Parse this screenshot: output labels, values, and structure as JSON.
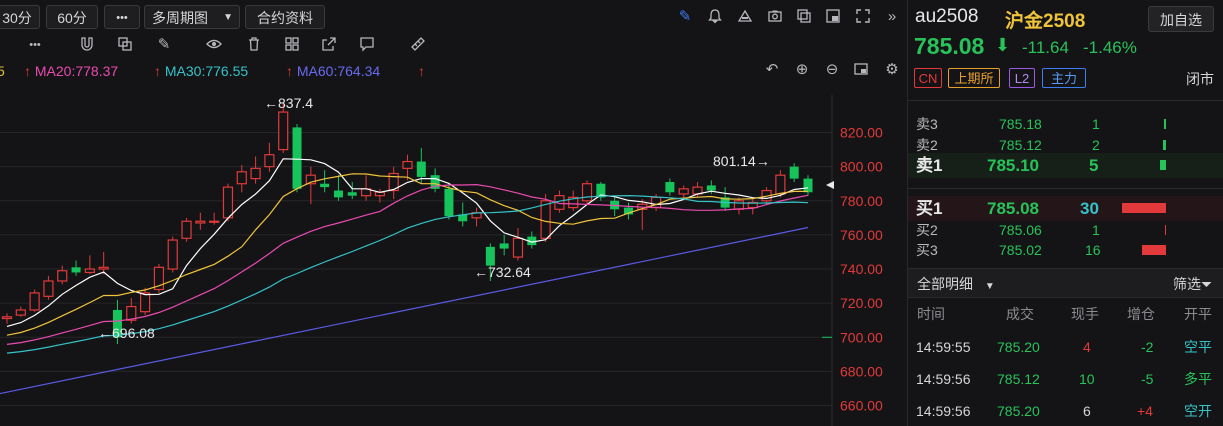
{
  "toolbar": {
    "btn_30": "30分",
    "btn_60": "60分",
    "btn_more": "•••",
    "btn_multi": "多周期图",
    "btn_contract": "合约资料",
    "icons": [
      "pen-icon",
      "bell-icon",
      "alert-icon",
      "camera-icon",
      "window-icon",
      "layout-icon",
      "fullscreen-icon",
      "collapse-icon"
    ]
  },
  "indicators": {
    "ma20": "MA20:778.37",
    "ma30": "MA30:776.55",
    "ma60": "MA60:764.34",
    "colors": {
      "ma5": "#ffffff",
      "ma10": "#f0c43a",
      "ma20": "#e94bb0",
      "ma30": "#35c3c8",
      "ma60": "#5a5ae6"
    }
  },
  "chart_data": {
    "type": "candlestick",
    "y_ticks": [
      "820.00",
      "800.00",
      "780.00",
      "760.00",
      "740.00",
      "720.00",
      "700.00",
      "680.00",
      "660.00"
    ],
    "ylim": [
      648,
      842
    ],
    "annotations": {
      "high": "←837.4",
      "low1": "←696.08",
      "low2": "←732.64",
      "recent": "801.14→"
    },
    "candles": [
      {
        "o": 711,
        "h": 714,
        "l": 708,
        "c": 712
      },
      {
        "o": 713,
        "h": 718,
        "l": 712,
        "c": 716
      },
      {
        "o": 716,
        "h": 728,
        "l": 715,
        "c": 726
      },
      {
        "o": 724,
        "h": 736,
        "l": 722,
        "c": 733
      },
      {
        "o": 733,
        "h": 742,
        "l": 731,
        "c": 739
      },
      {
        "o": 741,
        "h": 745,
        "l": 736,
        "c": 738
      },
      {
        "o": 738,
        "h": 748,
        "l": 737,
        "c": 740
      },
      {
        "o": 740,
        "h": 750,
        "l": 737,
        "c": 741
      },
      {
        "o": 716,
        "h": 722,
        "l": 696,
        "c": 700
      },
      {
        "o": 710,
        "h": 723,
        "l": 708,
        "c": 718
      },
      {
        "o": 715,
        "h": 729,
        "l": 713,
        "c": 726
      },
      {
        "o": 728,
        "h": 743,
        "l": 726,
        "c": 741
      },
      {
        "o": 740,
        "h": 759,
        "l": 738,
        "c": 757
      },
      {
        "o": 758,
        "h": 770,
        "l": 756,
        "c": 768
      },
      {
        "o": 767,
        "h": 773,
        "l": 763,
        "c": 768
      },
      {
        "o": 768,
        "h": 773,
        "l": 766,
        "c": 768
      },
      {
        "o": 770,
        "h": 790,
        "l": 768,
        "c": 788
      },
      {
        "o": 790,
        "h": 801,
        "l": 785,
        "c": 797
      },
      {
        "o": 793,
        "h": 806,
        "l": 790,
        "c": 799
      },
      {
        "o": 800,
        "h": 814,
        "l": 797,
        "c": 807
      },
      {
        "o": 810,
        "h": 837,
        "l": 808,
        "c": 832
      },
      {
        "o": 823,
        "h": 825,
        "l": 785,
        "c": 787
      },
      {
        "o": 790,
        "h": 800,
        "l": 778,
        "c": 795
      },
      {
        "o": 790,
        "h": 798,
        "l": 785,
        "c": 788
      },
      {
        "o": 786,
        "h": 795,
        "l": 780,
        "c": 782
      },
      {
        "o": 785,
        "h": 791,
        "l": 781,
        "c": 783
      },
      {
        "o": 783,
        "h": 795,
        "l": 780,
        "c": 787
      },
      {
        "o": 783,
        "h": 787,
        "l": 779,
        "c": 785
      },
      {
        "o": 786,
        "h": 800,
        "l": 781,
        "c": 796
      },
      {
        "o": 799,
        "h": 807,
        "l": 792,
        "c": 803
      },
      {
        "o": 803,
        "h": 811,
        "l": 790,
        "c": 794
      },
      {
        "o": 795,
        "h": 799,
        "l": 785,
        "c": 787
      },
      {
        "o": 787,
        "h": 790,
        "l": 769,
        "c": 771
      },
      {
        "o": 772,
        "h": 779,
        "l": 765,
        "c": 768
      },
      {
        "o": 770,
        "h": 776,
        "l": 765,
        "c": 773
      },
      {
        "o": 753,
        "h": 755,
        "l": 733,
        "c": 742
      },
      {
        "o": 755,
        "h": 760,
        "l": 748,
        "c": 752
      },
      {
        "o": 747,
        "h": 764,
        "l": 745,
        "c": 758
      },
      {
        "o": 759,
        "h": 762,
        "l": 752,
        "c": 754
      },
      {
        "o": 758,
        "h": 784,
        "l": 756,
        "c": 780
      },
      {
        "o": 775,
        "h": 786,
        "l": 773,
        "c": 783
      },
      {
        "o": 776,
        "h": 786,
        "l": 774,
        "c": 782
      },
      {
        "o": 780,
        "h": 792,
        "l": 778,
        "c": 790
      },
      {
        "o": 790,
        "h": 791,
        "l": 780,
        "c": 782
      },
      {
        "o": 780,
        "h": 783,
        "l": 771,
        "c": 775
      },
      {
        "o": 776,
        "h": 779,
        "l": 769,
        "c": 772
      },
      {
        "o": 775,
        "h": 781,
        "l": 763,
        "c": 778
      },
      {
        "o": 776,
        "h": 784,
        "l": 774,
        "c": 782
      },
      {
        "o": 791,
        "h": 793,
        "l": 783,
        "c": 785
      },
      {
        "o": 784,
        "h": 789,
        "l": 781,
        "c": 787
      },
      {
        "o": 784,
        "h": 791,
        "l": 782,
        "c": 788
      },
      {
        "o": 789,
        "h": 792,
        "l": 784,
        "c": 786
      },
      {
        "o": 782,
        "h": 788,
        "l": 774,
        "c": 776
      },
      {
        "o": 775,
        "h": 782,
        "l": 772,
        "c": 780
      },
      {
        "o": 776,
        "h": 781,
        "l": 772,
        "c": 779
      },
      {
        "o": 780,
        "h": 788,
        "l": 778,
        "c": 786
      },
      {
        "o": 784,
        "h": 798,
        "l": 782,
        "c": 795
      },
      {
        "o": 800,
        "h": 802,
        "l": 791,
        "c": 793
      },
      {
        "o": 793,
        "h": 795,
        "l": 783,
        "c": 785
      }
    ],
    "ma60_range": [
      667,
      764.34
    ]
  },
  "quote": {
    "symbol": "au2508",
    "name": "沪金2508",
    "add_watch": "加自选",
    "price": "785.08",
    "arrow": "⬇",
    "change": "-11.64",
    "pct": "-1.46%",
    "tags": [
      "CN",
      "上期所",
      "L2",
      "主力"
    ],
    "status": "闭市"
  },
  "book": {
    "asks": [
      {
        "label": "卖3",
        "price": "785.18",
        "vol": "1"
      },
      {
        "label": "卖2",
        "price": "785.12",
        "vol": "2"
      },
      {
        "label": "卖1",
        "price": "785.10",
        "vol": "5"
      }
    ],
    "bids": [
      {
        "label": "买1",
        "price": "785.08",
        "vol": "30"
      },
      {
        "label": "买2",
        "price": "785.06",
        "vol": "1"
      },
      {
        "label": "买3",
        "price": "785.02",
        "vol": "16"
      }
    ]
  },
  "trades": {
    "title": "全部明细",
    "filter": "筛选",
    "headers": [
      "时间",
      "成交",
      "现手",
      "增仓",
      "开平"
    ],
    "rows": [
      {
        "time": "14:59:55",
        "price": "785.20",
        "vol": "4",
        "oi": "-2",
        "type": "空平"
      },
      {
        "time": "14:59:56",
        "price": "785.12",
        "vol": "10",
        "oi": "-5",
        "type": "多平"
      },
      {
        "time": "14:59:56",
        "price": "785.20",
        "vol": "6",
        "oi": "+4",
        "type": "空开"
      }
    ]
  }
}
